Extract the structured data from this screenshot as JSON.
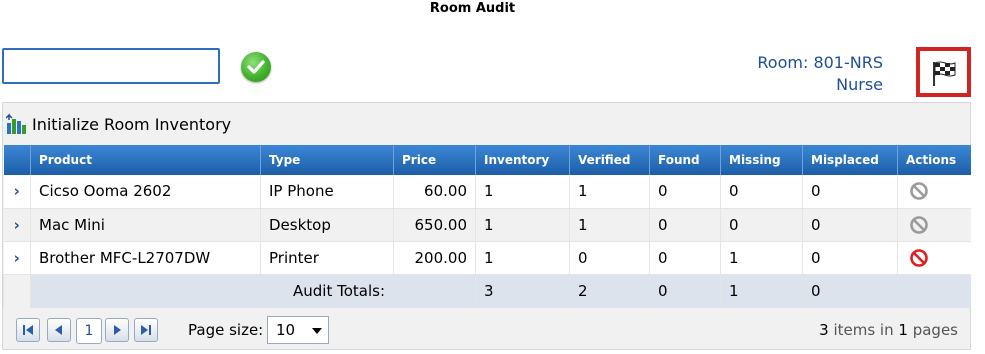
{
  "page": {
    "title": "Room Audit"
  },
  "scan": {
    "value": "",
    "placeholder": ""
  },
  "room": {
    "label": "Room: 801-NRS",
    "type": "Nurse"
  },
  "toolbar": {
    "init_label": "Initialize Room Inventory"
  },
  "columns": [
    "Product",
    "Type",
    "Price",
    "Inventory",
    "Verified",
    "Found",
    "Missing",
    "Misplaced",
    "Actions"
  ],
  "rows": [
    {
      "product": "Cicso Ooma 2602",
      "type": "IP Phone",
      "price": "60.00",
      "inventory": "1",
      "verified": "1",
      "found": "0",
      "missing": "0",
      "misplaced": "0",
      "action_icon": "cancel-disabled-icon"
    },
    {
      "product": "Mac Mini",
      "type": "Desktop",
      "price": "650.00",
      "inventory": "1",
      "verified": "1",
      "found": "0",
      "missing": "0",
      "misplaced": "0",
      "action_icon": "cancel-disabled-icon"
    },
    {
      "product": "Brother MFC-L2707DW",
      "type": "Printer",
      "price": "200.00",
      "inventory": "1",
      "verified": "0",
      "found": "0",
      "missing": "1",
      "misplaced": "0",
      "action_icon": "cancel-active-icon"
    }
  ],
  "totals": {
    "label": "Audit Totals:",
    "inventory": "3",
    "verified": "2",
    "found": "0",
    "missing": "1",
    "misplaced": "0"
  },
  "pager": {
    "current_page": "1",
    "page_size_label": "Page size:",
    "page_size": "10",
    "items_count": "3",
    "items_text_1": "items in",
    "page_count": "1",
    "items_text_2": "pages"
  },
  "colors": {
    "accent_blue": "#1f4e9c",
    "header_blue": "#2a72c2",
    "flag_border": "#d22420",
    "check_green": "#43b12e"
  }
}
